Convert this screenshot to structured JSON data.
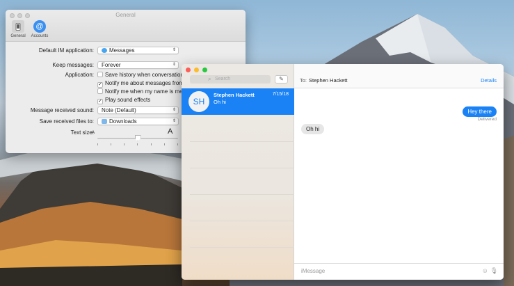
{
  "prefs_window": {
    "title": "General",
    "tabs": [
      {
        "label": "General",
        "icon": "phone-icon"
      },
      {
        "label": "Accounts",
        "icon": "at-sign-icon"
      }
    ],
    "default_im": {
      "label": "Default IM application:",
      "value": "Messages"
    },
    "keep_messages": {
      "label": "Keep messages:",
      "value": "Forever"
    },
    "application": {
      "label": "Application:",
      "options": [
        {
          "label": "Save history when conversations",
          "checked": false
        },
        {
          "label": "Notify me about messages from",
          "checked": true
        },
        {
          "label": "Notify me when my name is men",
          "checked": false
        },
        {
          "label": "Play sound effects",
          "checked": true
        }
      ]
    },
    "received_sound": {
      "label": "Message received sound:",
      "value": "Note (Default)"
    },
    "save_files": {
      "label": "Save received files to:",
      "value": "Downloads"
    },
    "text_size": {
      "label": "Text size:",
      "small": "A",
      "large": "A",
      "level": 0.5
    }
  },
  "messages_window": {
    "search_placeholder": "Search",
    "conversation": {
      "initials": "SH",
      "name": "Stephen Hackett",
      "date": "7/15/18",
      "preview": "Oh hi"
    },
    "header": {
      "to_label": "To:",
      "to_name": "Stephen Hackett",
      "details": "Details"
    },
    "messages": [
      {
        "text": "Hey there",
        "direction": "out"
      },
      {
        "text": "Oh hi",
        "direction": "in"
      }
    ],
    "delivered": "Delivered",
    "input_placeholder": "iMessage"
  },
  "colors": {
    "accent": "#1a82f4",
    "close": "#fc5f57",
    "minimize": "#fdbc2e",
    "zoom": "#28c840"
  }
}
